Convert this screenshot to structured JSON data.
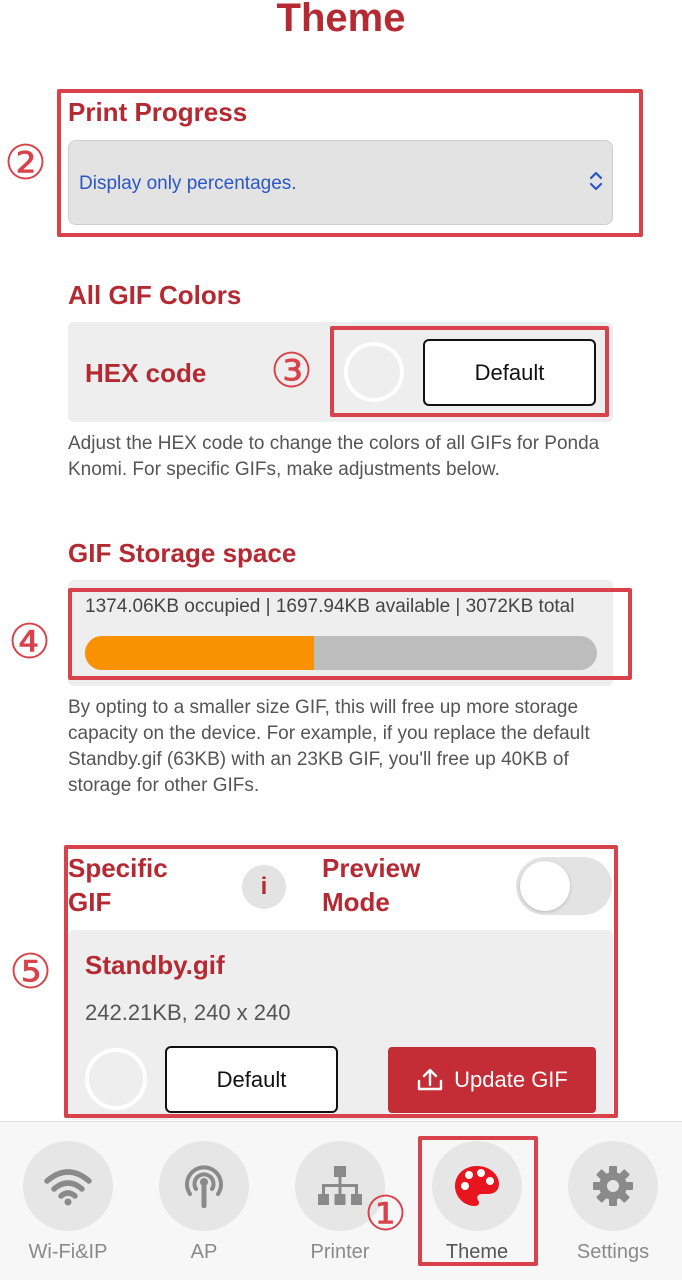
{
  "header": {
    "title": "Theme"
  },
  "print_progress": {
    "heading": "Print Progress",
    "selected": "Display only percentages."
  },
  "gif_colors": {
    "heading": "All GIF Colors",
    "hex_label": "HEX code",
    "default_button": "Default",
    "help": "Adjust the HEX code to change the colors of all GIFs for Ponda Knomi. For specific GIFs, make adjustments below."
  },
  "storage": {
    "heading": "GIF Storage space",
    "summary": "1374.06KB occupied | 1697.94KB available | 3072KB total",
    "used_fraction": 0.447,
    "bar_color": "#fa9100",
    "help": "By opting to a smaller size GIF, this will free up more storage capacity on the device. For example, if you replace the default Standby.gif (63KB) with an 23KB GIF, you'll free up 40KB of storage for other GIFs."
  },
  "specific_gif": {
    "heading": "Specific GIF",
    "info_icon": "i",
    "preview_label": "Preview Mode",
    "preview_on": false,
    "card": {
      "name": "Standby.gif",
      "meta": "242.21KB, 240 x 240",
      "default_button": "Default",
      "update_button": "Update GIF"
    }
  },
  "nav": {
    "items": [
      {
        "label": "Wi-Fi&IP",
        "icon": "wifi-icon",
        "active": false
      },
      {
        "label": "AP",
        "icon": "antenna-icon",
        "active": false
      },
      {
        "label": "Printer",
        "icon": "network-tree-icon",
        "active": false
      },
      {
        "label": "Theme",
        "icon": "palette-icon",
        "active": true
      },
      {
        "label": "Settings",
        "icon": "gear-icon",
        "active": false
      }
    ]
  },
  "annotations": [
    "①",
    "②",
    "③",
    "④",
    "⑤"
  ],
  "colors": {
    "brand_red": "#b52a32",
    "annotation_red": "#d8434b",
    "active_icon": "#e8141e",
    "inactive_icon": "#8a8a8a"
  }
}
